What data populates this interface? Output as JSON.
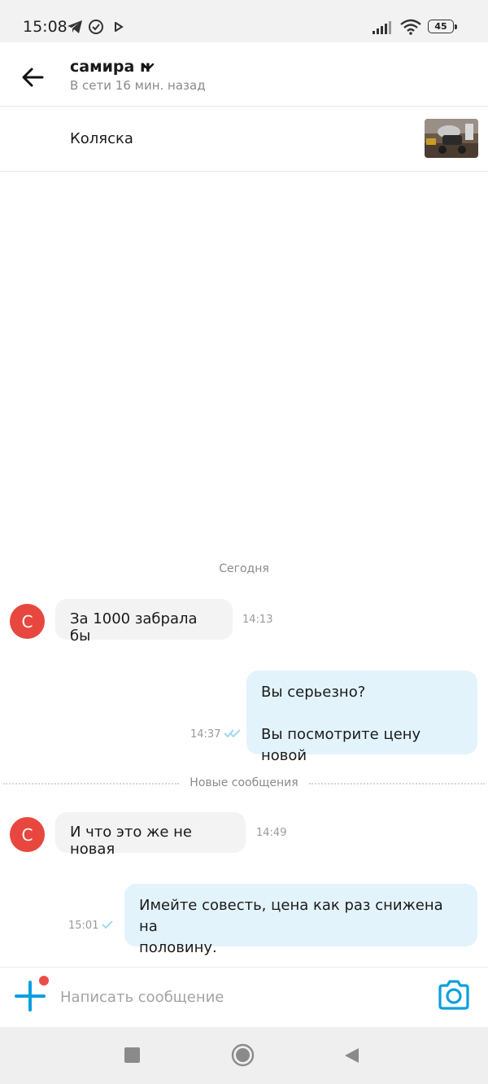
{
  "status_bar": {
    "time": "15:08",
    "battery": "45",
    "icons": [
      "telegram-icon",
      "check-circle-icon",
      "play-icon",
      "signal-icon",
      "wifi-icon",
      "battery-icon"
    ]
  },
  "header": {
    "contact_name": "самира н",
    "contact_status": "В сети 16 мин. назад",
    "icons": [
      "back-arrow-icon",
      "chevron-down-icon"
    ]
  },
  "listing": {
    "title": "Коляска",
    "thumbnail": "listing-thumbnail"
  },
  "chat": {
    "date_label": "Сегодня",
    "new_messages_label": "Новые сообщения",
    "avatar_letter": "С",
    "messages": [
      {
        "direction": "in",
        "text": "За 1000 забрала бы",
        "time": "14:13"
      },
      {
        "direction": "out",
        "lines": [
          "Вы серьезно?",
          "",
          "Вы посмотрите цену новой"
        ],
        "time": "14:37",
        "status": "read"
      },
      {
        "direction": "in",
        "text": "И что это же не новая",
        "time": "14:49"
      },
      {
        "direction": "out",
        "lines": [
          "Имейте совесть, цена как раз снижена на",
          "половину."
        ],
        "time": "15:01",
        "status": "sent"
      }
    ]
  },
  "composer": {
    "placeholder": "Написать сообщение",
    "value": "",
    "icons": [
      "plus-icon",
      "camera-icon"
    ]
  },
  "colors": {
    "accent": "#0aa0dc",
    "avatar": "#e8473f",
    "outgoing_bubble": "#e2f3fc",
    "incoming_bubble": "#f3f3f3",
    "notification_dot": "#ea4d45"
  }
}
